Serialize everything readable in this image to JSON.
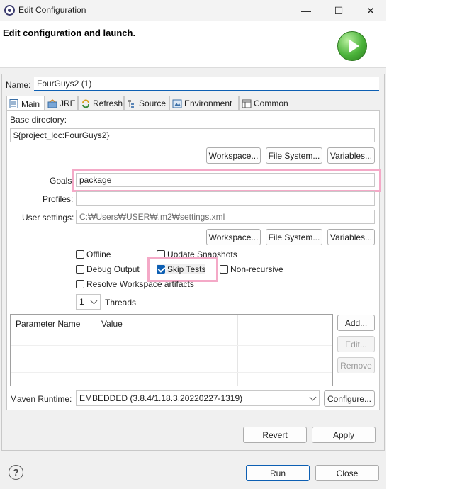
{
  "window": {
    "title": "Edit Configuration",
    "min_glyph": "—",
    "max_glyph": "☐",
    "close_glyph": "✕"
  },
  "header": {
    "text": "Edit configuration and launch."
  },
  "name": {
    "label": "Name:",
    "value": "FourGuys2 (1)"
  },
  "tabs": [
    {
      "label": "Main",
      "icon": "main-tab-icon",
      "active": true
    },
    {
      "label": "JRE",
      "icon": "jre-icon",
      "active": false
    },
    {
      "label": "Refresh",
      "icon": "refresh-icon",
      "active": false
    },
    {
      "label": "Source",
      "icon": "source-icon",
      "active": false
    },
    {
      "label": "Environment",
      "icon": "environment-icon",
      "active": false
    },
    {
      "label": "Common",
      "icon": "common-icon",
      "active": false
    }
  ],
  "main": {
    "base_dir_label": "Base directory:",
    "base_dir_value": "${project_loc:FourGuys2}",
    "workspace_btn": "Workspace...",
    "filesystem_btn": "File System...",
    "variables_btn": "Variables...",
    "goals_label": "Goals:",
    "goals_value": "package",
    "profiles_label": "Profiles:",
    "profiles_value": "",
    "user_settings_label": "User settings:",
    "user_settings_value": "C:₩Users₩USER₩.m2₩settings.xml",
    "offline": "Offline",
    "update_snapshots": "Update Snapshots",
    "debug_output": "Debug Output",
    "skip_tests": "Skip Tests",
    "non_recursive": "Non-recursive",
    "resolve_workspace": "Resolve Workspace artifacts",
    "threads_value": "1",
    "threads_label": "Threads",
    "table": {
      "col_param": "Parameter Name",
      "col_value": "Value"
    },
    "add_btn": "Add...",
    "edit_btn": "Edit...",
    "remove_btn": "Remove",
    "runtime_label": "Maven Runtime:",
    "runtime_value": "EMBEDDED (3.8.4/1.18.3.20220227-1319)",
    "configure_btn": "Configure..."
  },
  "footer": {
    "revert": "Revert",
    "apply": "Apply",
    "run": "Run",
    "close": "Close",
    "help_glyph": "?"
  },
  "colors": {
    "accent": "#0d5fb3",
    "highlight": "#f4a9c7",
    "launch_green": "#4bb33a"
  }
}
